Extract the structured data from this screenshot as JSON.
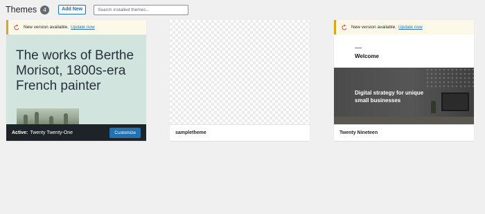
{
  "header": {
    "title": "Themes",
    "count": "4",
    "add_new_label": "Add New",
    "search_placeholder": "Search installed themes..."
  },
  "notice": {
    "message": "New version available.",
    "link": "Update now"
  },
  "themes": [
    {
      "name": "Twenty Twenty-One",
      "active": true,
      "active_label": "Active:",
      "customize_label": "Customize",
      "has_update": true,
      "preview_headline": "The works of Berthe Morisot, 1800s-era French painter"
    },
    {
      "name": "sampletheme",
      "active": false,
      "has_update": false
    },
    {
      "name": "Twenty Nineteen",
      "active": false,
      "has_update": true,
      "preview_heading": "Welcome",
      "preview_hero": "Digital strategy for unique small businesses"
    }
  ],
  "colors": {
    "accent": "#2271b1",
    "notice_border": "#dba617",
    "notice_bg": "#fcf9e8",
    "update_icon": "#d63638",
    "active_footer": "#1d2327",
    "tt1_bg": "#d1e4dd"
  }
}
